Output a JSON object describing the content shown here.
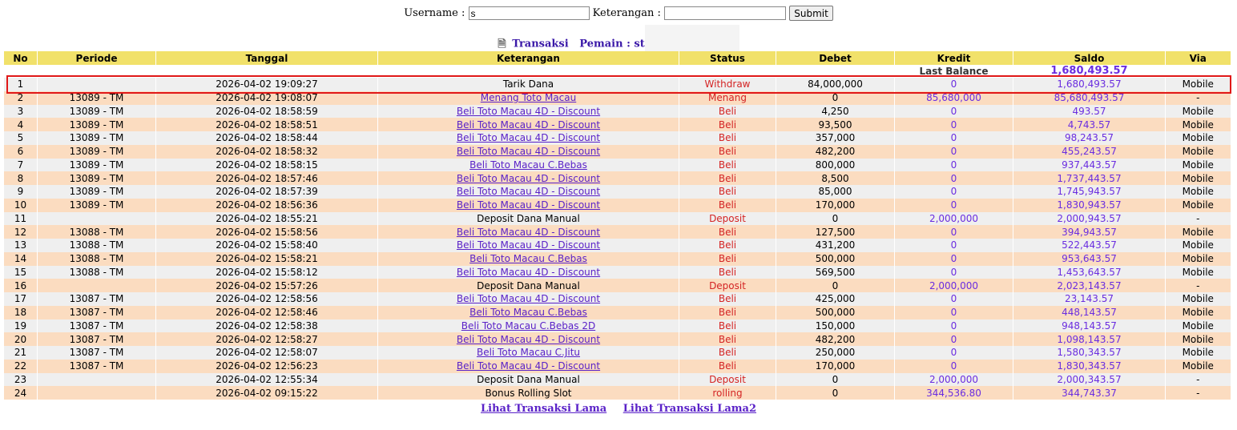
{
  "form": {
    "username_label": "Username :",
    "username_value": "s",
    "keterangan_label": "Keterangan :",
    "keterangan_value": "",
    "submit_label": "Submit"
  },
  "caption": {
    "transaksi": "Transaksi",
    "pemain": "Pemain : st"
  },
  "columns": [
    "No",
    "Periode",
    "Tanggal",
    "Keterangan",
    "Status",
    "Debet",
    "Kredit",
    "Saldo",
    "Via"
  ],
  "last_balance": {
    "label": "Last Balance",
    "value": "1,680,493.57"
  },
  "rows": [
    {
      "no": "1",
      "periode": "",
      "tanggal": "2026-04-02 19:09:27",
      "ket": "Tarik Dana",
      "link": false,
      "status": "Withdraw",
      "debet": "84,000,000",
      "kredit": "0",
      "saldo": "1,680,493.57",
      "via": "Mobile"
    },
    {
      "no": "2",
      "periode": "13089 - TM",
      "tanggal": "2026-04-02 19:08:07",
      "ket": "Menang Toto Macau",
      "link": true,
      "status": "Menang",
      "debet": "0",
      "kredit": "85,680,000",
      "saldo": "85,680,493.57",
      "via": "-"
    },
    {
      "no": "3",
      "periode": "13089 - TM",
      "tanggal": "2026-04-02 18:58:59",
      "ket": "Beli Toto Macau 4D - Discount",
      "link": true,
      "status": "Beli",
      "debet": "4,250",
      "kredit": "0",
      "saldo": "493.57",
      "via": "Mobile"
    },
    {
      "no": "4",
      "periode": "13089 - TM",
      "tanggal": "2026-04-02 18:58:51",
      "ket": "Beli Toto Macau 4D - Discount",
      "link": true,
      "status": "Beli",
      "debet": "93,500",
      "kredit": "0",
      "saldo": "4,743.57",
      "via": "Mobile"
    },
    {
      "no": "5",
      "periode": "13089 - TM",
      "tanggal": "2026-04-02 18:58:44",
      "ket": "Beli Toto Macau 4D - Discount",
      "link": true,
      "status": "Beli",
      "debet": "357,000",
      "kredit": "0",
      "saldo": "98,243.57",
      "via": "Mobile"
    },
    {
      "no": "6",
      "periode": "13089 - TM",
      "tanggal": "2026-04-02 18:58:32",
      "ket": "Beli Toto Macau 4D - Discount",
      "link": true,
      "status": "Beli",
      "debet": "482,200",
      "kredit": "0",
      "saldo": "455,243.57",
      "via": "Mobile"
    },
    {
      "no": "7",
      "periode": "13089 - TM",
      "tanggal": "2026-04-02 18:58:15",
      "ket": "Beli Toto Macau C.Bebas",
      "link": true,
      "status": "Beli",
      "debet": "800,000",
      "kredit": "0",
      "saldo": "937,443.57",
      "via": "Mobile"
    },
    {
      "no": "8",
      "periode": "13089 - TM",
      "tanggal": "2026-04-02 18:57:46",
      "ket": "Beli Toto Macau 4D - Discount",
      "link": true,
      "status": "Beli",
      "debet": "8,500",
      "kredit": "0",
      "saldo": "1,737,443.57",
      "via": "Mobile"
    },
    {
      "no": "9",
      "periode": "13089 - TM",
      "tanggal": "2026-04-02 18:57:39",
      "ket": "Beli Toto Macau 4D - Discount",
      "link": true,
      "status": "Beli",
      "debet": "85,000",
      "kredit": "0",
      "saldo": "1,745,943.57",
      "via": "Mobile"
    },
    {
      "no": "10",
      "periode": "13089 - TM",
      "tanggal": "2026-04-02 18:56:36",
      "ket": "Beli Toto Macau 4D - Discount",
      "link": true,
      "status": "Beli",
      "debet": "170,000",
      "kredit": "0",
      "saldo": "1,830,943.57",
      "via": "Mobile"
    },
    {
      "no": "11",
      "periode": "",
      "tanggal": "2026-04-02 18:55:21",
      "ket": "Deposit Dana Manual",
      "link": false,
      "status": "Deposit",
      "debet": "0",
      "kredit": "2,000,000",
      "saldo": "2,000,943.57",
      "via": "-"
    },
    {
      "no": "12",
      "periode": "13088 - TM",
      "tanggal": "2026-04-02 15:58:56",
      "ket": "Beli Toto Macau 4D - Discount",
      "link": true,
      "status": "Beli",
      "debet": "127,500",
      "kredit": "0",
      "saldo": "394,943.57",
      "via": "Mobile"
    },
    {
      "no": "13",
      "periode": "13088 - TM",
      "tanggal": "2026-04-02 15:58:40",
      "ket": "Beli Toto Macau 4D - Discount",
      "link": true,
      "status": "Beli",
      "debet": "431,200",
      "kredit": "0",
      "saldo": "522,443.57",
      "via": "Mobile"
    },
    {
      "no": "14",
      "periode": "13088 - TM",
      "tanggal": "2026-04-02 15:58:21",
      "ket": "Beli Toto Macau C.Bebas",
      "link": true,
      "status": "Beli",
      "debet": "500,000",
      "kredit": "0",
      "saldo": "953,643.57",
      "via": "Mobile"
    },
    {
      "no": "15",
      "periode": "13088 - TM",
      "tanggal": "2026-04-02 15:58:12",
      "ket": "Beli Toto Macau 4D - Discount",
      "link": true,
      "status": "Beli",
      "debet": "569,500",
      "kredit": "0",
      "saldo": "1,453,643.57",
      "via": "Mobile"
    },
    {
      "no": "16",
      "periode": "",
      "tanggal": "2026-04-02 15:57:26",
      "ket": "Deposit Dana Manual",
      "link": false,
      "status": "Deposit",
      "debet": "0",
      "kredit": "2,000,000",
      "saldo": "2,023,143.57",
      "via": "-"
    },
    {
      "no": "17",
      "periode": "13087 - TM",
      "tanggal": "2026-04-02 12:58:56",
      "ket": "Beli Toto Macau 4D - Discount",
      "link": true,
      "status": "Beli",
      "debet": "425,000",
      "kredit": "0",
      "saldo": "23,143.57",
      "via": "Mobile"
    },
    {
      "no": "18",
      "periode": "13087 - TM",
      "tanggal": "2026-04-02 12:58:46",
      "ket": "Beli Toto Macau C.Bebas",
      "link": true,
      "status": "Beli",
      "debet": "500,000",
      "kredit": "0",
      "saldo": "448,143.57",
      "via": "Mobile"
    },
    {
      "no": "19",
      "periode": "13087 - TM",
      "tanggal": "2026-04-02 12:58:38",
      "ket": "Beli Toto Macau C.Bebas 2D",
      "link": true,
      "status": "Beli",
      "debet": "150,000",
      "kredit": "0",
      "saldo": "948,143.57",
      "via": "Mobile"
    },
    {
      "no": "20",
      "periode": "13087 - TM",
      "tanggal": "2026-04-02 12:58:27",
      "ket": "Beli Toto Macau 4D - Discount",
      "link": true,
      "status": "Beli",
      "debet": "482,200",
      "kredit": "0",
      "saldo": "1,098,143.57",
      "via": "Mobile"
    },
    {
      "no": "21",
      "periode": "13087 - TM",
      "tanggal": "2026-04-02 12:58:07",
      "ket": "Beli Toto Macau C.Jitu",
      "link": true,
      "status": "Beli",
      "debet": "250,000",
      "kredit": "0",
      "saldo": "1,580,343.57",
      "via": "Mobile"
    },
    {
      "no": "22",
      "periode": "13087 - TM",
      "tanggal": "2026-04-02 12:56:23",
      "ket": "Beli Toto Macau 4D - Discount",
      "link": true,
      "status": "Beli",
      "debet": "170,000",
      "kredit": "0",
      "saldo": "1,830,343.57",
      "via": "Mobile"
    },
    {
      "no": "23",
      "periode": "",
      "tanggal": "2026-04-02 12:55:34",
      "ket": "Deposit Dana Manual",
      "link": false,
      "status": "Deposit",
      "debet": "0",
      "kredit": "2,000,000",
      "saldo": "2,000,343.57",
      "via": "-"
    },
    {
      "no": "24",
      "periode": "",
      "tanggal": "2026-04-02 09:15:22",
      "ket": "Bonus Rolling Slot",
      "link": false,
      "status": "rolling",
      "debet": "0",
      "kredit": "344,536.80",
      "saldo": "344,743.37",
      "via": "-"
    }
  ],
  "footer": {
    "link1": "Lihat Transaksi Lama",
    "link2": "Lihat Transaksi Lama2"
  },
  "colors": {
    "header_bg": "#f1e16a",
    "row_even": "#fbdcc0",
    "row_odd": "#efefef",
    "link": "#5a22c8",
    "status": "#d42424",
    "highlight": "#e01818"
  }
}
